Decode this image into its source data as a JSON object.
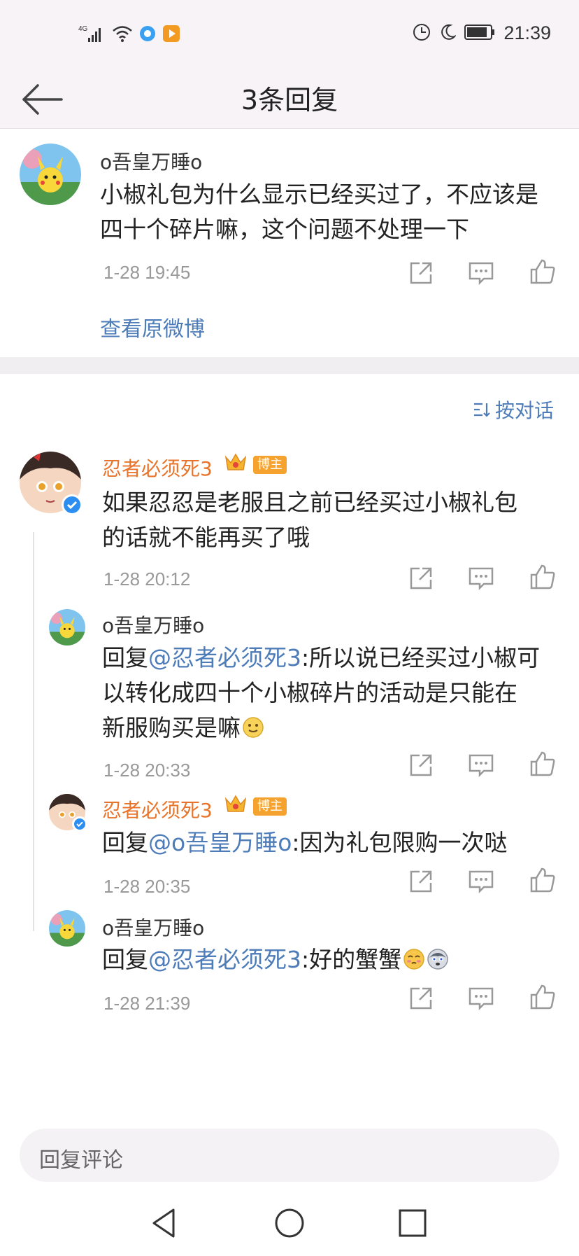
{
  "status_bar": {
    "network": "4G",
    "time": "21:39"
  },
  "header": {
    "title": "3条回复"
  },
  "original_comment": {
    "username": "o吾皇万睡o",
    "text_line1": "小椒礼包为什么显示已经买过了，不应该是",
    "text_line2": "四十个碎片嘛，这个问题不处理一下",
    "time": "1-28 19:45",
    "view_original_label": "查看原微博"
  },
  "sort_label": "按对话",
  "replies": [
    {
      "username": "忍者必须死3",
      "host_badge": "博主",
      "text_line1": "如果忍忍是老服且之前已经买过小椒礼包",
      "text_line2": "的话就不能再买了哦",
      "time": "1-28 20:12"
    },
    {
      "username": "o吾皇万睡o",
      "reply_prefix": "回复",
      "mention": "@忍者必须死3",
      "text_line1": ":所以说已经买过小椒可",
      "text_line2": "以转化成四十个小椒碎片的活动是只能在",
      "text_line3": "新服购买是嘛",
      "time": "1-28 20:33"
    },
    {
      "username": "忍者必须死3",
      "host_badge": "博主",
      "reply_prefix": "回复",
      "mention": "@o吾皇万睡o",
      "text_line1": ":因为礼包限购一次哒",
      "time": "1-28 20:35"
    },
    {
      "username": "o吾皇万睡o",
      "reply_prefix": "回复",
      "mention": "@忍者必须死3",
      "text_line1": ":好的蟹蟹",
      "time": "1-28 21:39"
    }
  ],
  "reply_input": {
    "placeholder": "回复评论"
  },
  "colors": {
    "link_blue": "#4e7cb8",
    "blogger_orange": "#e8732a",
    "badge_orange": "#f5a32e"
  }
}
